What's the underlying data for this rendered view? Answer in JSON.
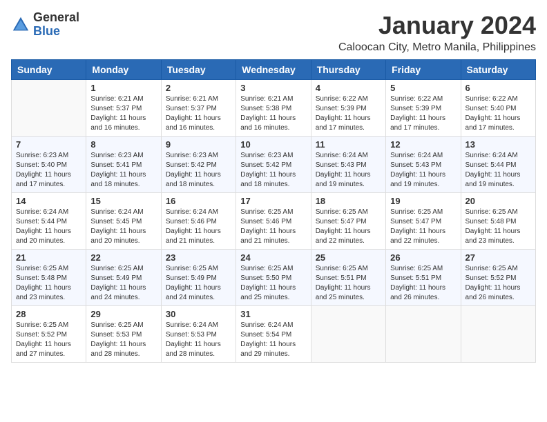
{
  "logo": {
    "general": "General",
    "blue": "Blue"
  },
  "title": "January 2024",
  "subtitle": "Caloocan City, Metro Manila, Philippines",
  "headers": [
    "Sunday",
    "Monday",
    "Tuesday",
    "Wednesday",
    "Thursday",
    "Friday",
    "Saturday"
  ],
  "weeks": [
    [
      {
        "day": "",
        "info": ""
      },
      {
        "day": "1",
        "info": "Sunrise: 6:21 AM\nSunset: 5:37 PM\nDaylight: 11 hours\nand 16 minutes."
      },
      {
        "day": "2",
        "info": "Sunrise: 6:21 AM\nSunset: 5:37 PM\nDaylight: 11 hours\nand 16 minutes."
      },
      {
        "day": "3",
        "info": "Sunrise: 6:21 AM\nSunset: 5:38 PM\nDaylight: 11 hours\nand 16 minutes."
      },
      {
        "day": "4",
        "info": "Sunrise: 6:22 AM\nSunset: 5:39 PM\nDaylight: 11 hours\nand 17 minutes."
      },
      {
        "day": "5",
        "info": "Sunrise: 6:22 AM\nSunset: 5:39 PM\nDaylight: 11 hours\nand 17 minutes."
      },
      {
        "day": "6",
        "info": "Sunrise: 6:22 AM\nSunset: 5:40 PM\nDaylight: 11 hours\nand 17 minutes."
      }
    ],
    [
      {
        "day": "7",
        "info": "Sunrise: 6:23 AM\nSunset: 5:40 PM\nDaylight: 11 hours\nand 17 minutes."
      },
      {
        "day": "8",
        "info": "Sunrise: 6:23 AM\nSunset: 5:41 PM\nDaylight: 11 hours\nand 18 minutes."
      },
      {
        "day": "9",
        "info": "Sunrise: 6:23 AM\nSunset: 5:42 PM\nDaylight: 11 hours\nand 18 minutes."
      },
      {
        "day": "10",
        "info": "Sunrise: 6:23 AM\nSunset: 5:42 PM\nDaylight: 11 hours\nand 18 minutes."
      },
      {
        "day": "11",
        "info": "Sunrise: 6:24 AM\nSunset: 5:43 PM\nDaylight: 11 hours\nand 19 minutes."
      },
      {
        "day": "12",
        "info": "Sunrise: 6:24 AM\nSunset: 5:43 PM\nDaylight: 11 hours\nand 19 minutes."
      },
      {
        "day": "13",
        "info": "Sunrise: 6:24 AM\nSunset: 5:44 PM\nDaylight: 11 hours\nand 19 minutes."
      }
    ],
    [
      {
        "day": "14",
        "info": "Sunrise: 6:24 AM\nSunset: 5:44 PM\nDaylight: 11 hours\nand 20 minutes."
      },
      {
        "day": "15",
        "info": "Sunrise: 6:24 AM\nSunset: 5:45 PM\nDaylight: 11 hours\nand 20 minutes."
      },
      {
        "day": "16",
        "info": "Sunrise: 6:24 AM\nSunset: 5:46 PM\nDaylight: 11 hours\nand 21 minutes."
      },
      {
        "day": "17",
        "info": "Sunrise: 6:25 AM\nSunset: 5:46 PM\nDaylight: 11 hours\nand 21 minutes."
      },
      {
        "day": "18",
        "info": "Sunrise: 6:25 AM\nSunset: 5:47 PM\nDaylight: 11 hours\nand 22 minutes."
      },
      {
        "day": "19",
        "info": "Sunrise: 6:25 AM\nSunset: 5:47 PM\nDaylight: 11 hours\nand 22 minutes."
      },
      {
        "day": "20",
        "info": "Sunrise: 6:25 AM\nSunset: 5:48 PM\nDaylight: 11 hours\nand 23 minutes."
      }
    ],
    [
      {
        "day": "21",
        "info": "Sunrise: 6:25 AM\nSunset: 5:48 PM\nDaylight: 11 hours\nand 23 minutes."
      },
      {
        "day": "22",
        "info": "Sunrise: 6:25 AM\nSunset: 5:49 PM\nDaylight: 11 hours\nand 24 minutes."
      },
      {
        "day": "23",
        "info": "Sunrise: 6:25 AM\nSunset: 5:49 PM\nDaylight: 11 hours\nand 24 minutes."
      },
      {
        "day": "24",
        "info": "Sunrise: 6:25 AM\nSunset: 5:50 PM\nDaylight: 11 hours\nand 25 minutes."
      },
      {
        "day": "25",
        "info": "Sunrise: 6:25 AM\nSunset: 5:51 PM\nDaylight: 11 hours\nand 25 minutes."
      },
      {
        "day": "26",
        "info": "Sunrise: 6:25 AM\nSunset: 5:51 PM\nDaylight: 11 hours\nand 26 minutes."
      },
      {
        "day": "27",
        "info": "Sunrise: 6:25 AM\nSunset: 5:52 PM\nDaylight: 11 hours\nand 26 minutes."
      }
    ],
    [
      {
        "day": "28",
        "info": "Sunrise: 6:25 AM\nSunset: 5:52 PM\nDaylight: 11 hours\nand 27 minutes."
      },
      {
        "day": "29",
        "info": "Sunrise: 6:25 AM\nSunset: 5:53 PM\nDaylight: 11 hours\nand 28 minutes."
      },
      {
        "day": "30",
        "info": "Sunrise: 6:24 AM\nSunset: 5:53 PM\nDaylight: 11 hours\nand 28 minutes."
      },
      {
        "day": "31",
        "info": "Sunrise: 6:24 AM\nSunset: 5:54 PM\nDaylight: 11 hours\nand 29 minutes."
      },
      {
        "day": "",
        "info": ""
      },
      {
        "day": "",
        "info": ""
      },
      {
        "day": "",
        "info": ""
      }
    ]
  ]
}
